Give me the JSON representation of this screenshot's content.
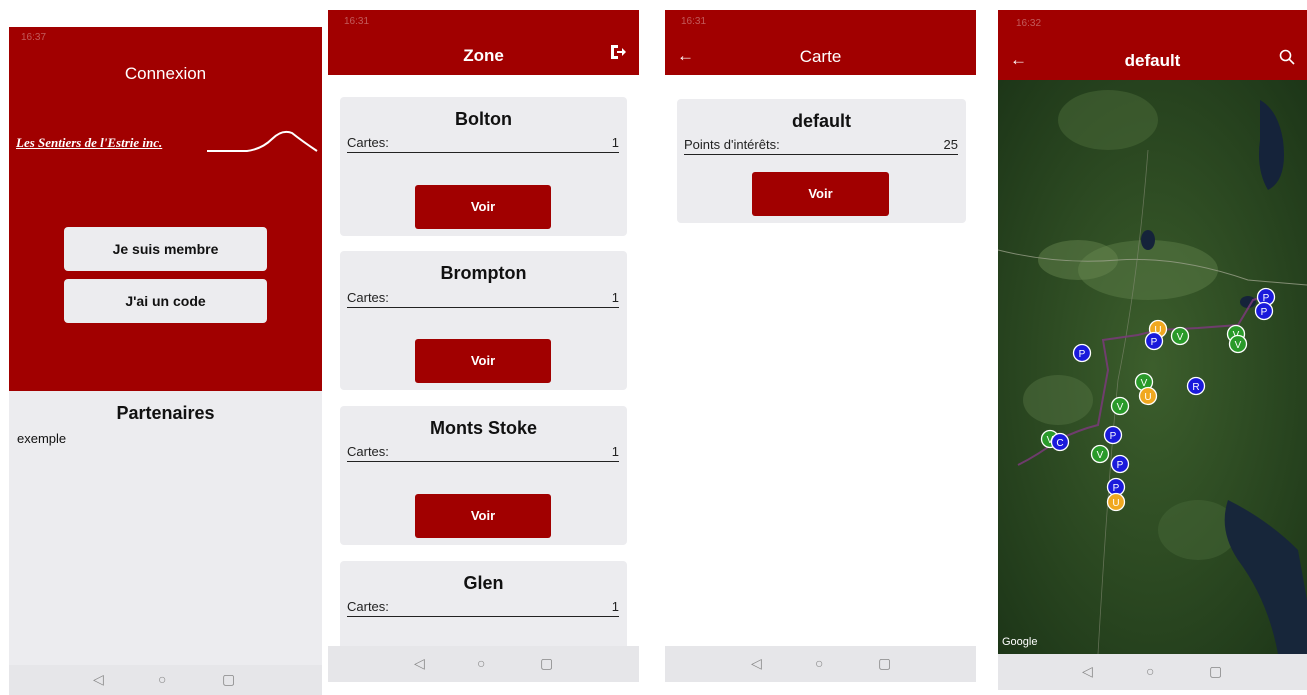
{
  "colors": {
    "brand_red": "#a10000",
    "panel": "#ececef",
    "nav": "#e6e6e9"
  },
  "screen1": {
    "status_time": "16:37",
    "title": "Connexion",
    "logo_text": "Les Sentiers de l'Estrie inc.",
    "member_button": "Je suis membre",
    "code_button": "J'ai un code",
    "partners_title": "Partenaires",
    "partners": [
      "exemple"
    ]
  },
  "screen2": {
    "status_time": "16:31",
    "title": "Zone",
    "logout_icon": "logout-icon",
    "row_label": "Cartes:",
    "button_label": "Voir",
    "zones": [
      {
        "name": "Bolton",
        "cartes": "1"
      },
      {
        "name": "Brompton",
        "cartes": "1"
      },
      {
        "name": "Monts Stoke",
        "cartes": "1"
      },
      {
        "name": "Glen",
        "cartes": "1"
      }
    ]
  },
  "screen3": {
    "status_time": "16:31",
    "title": "Carte",
    "back_icon": "arrow-left-icon",
    "map_name": "default",
    "poi_label": "Points d'intérêts:",
    "poi_count": "25",
    "button_label": "Voir"
  },
  "screen4": {
    "status_time": "16:32",
    "title": "default",
    "back_icon": "arrow-left-icon",
    "search_icon": "search-icon",
    "map_attribution": "Google",
    "markers": [
      {
        "letter": "P",
        "color": "#1a1adb"
      },
      {
        "letter": "P",
        "color": "#1a1adb"
      },
      {
        "letter": "U",
        "color": "#f0a820"
      },
      {
        "letter": "P",
        "color": "#1a1adb"
      },
      {
        "letter": "V",
        "color": "#2a9a2a"
      },
      {
        "letter": "V",
        "color": "#2a9a2a"
      },
      {
        "letter": "V",
        "color": "#2a9a2a"
      },
      {
        "letter": "P",
        "color": "#1a1adb"
      },
      {
        "letter": "V",
        "color": "#2a9a2a"
      },
      {
        "letter": "U",
        "color": "#f0a820"
      },
      {
        "letter": "R",
        "color": "#1a1adb"
      },
      {
        "letter": "V",
        "color": "#2a9a2a"
      },
      {
        "letter": "V",
        "color": "#2a9a2a"
      },
      {
        "letter": "C",
        "color": "#1a1adb"
      },
      {
        "letter": "P",
        "color": "#1a1adb"
      },
      {
        "letter": "V",
        "color": "#2a9a2a"
      },
      {
        "letter": "P",
        "color": "#1a1adb"
      },
      {
        "letter": "P",
        "color": "#1a1adb"
      },
      {
        "letter": "U",
        "color": "#f0a820"
      }
    ]
  }
}
